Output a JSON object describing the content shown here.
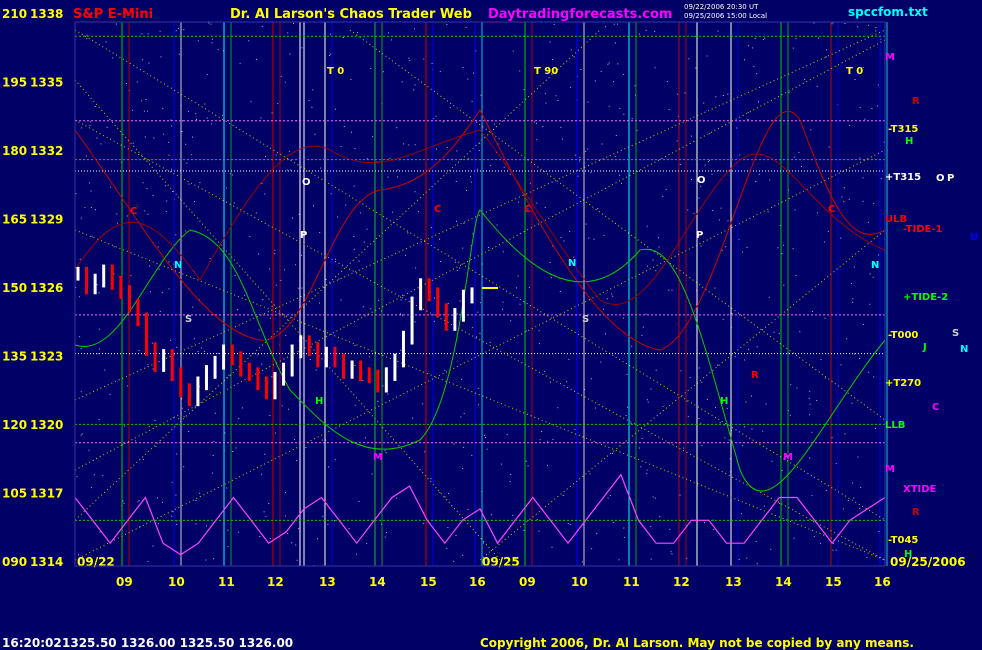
{
  "header": {
    "title_left": "S&P E-Mini",
    "title_center": "Dr. Al Larson's Chaos Trader Web",
    "site": "Daytradingforecasts.com",
    "stamp_line1": "09/22/2006 20:30 UT",
    "stamp_line2": "09/25/2006 15:00 Local",
    "file": "spccfom.txt"
  },
  "footer": {
    "time": "16:20:02",
    "quote": "1325.50  1326.00  1325.50  1326.00",
    "copyright": "Copyright 2006, Dr. Al Larson. May not be copied by any means."
  },
  "colors": {
    "background": "#000066",
    "axis_text": "#ffff00",
    "time_labels": "#ffff00",
    "price_up": "#ffffff",
    "price_down": "#ff0000",
    "fast_field": "#ff44ff",
    "slow_field_green": "#00cc00",
    "slow_field_red": "#cc0000",
    "grid_dots": "#ffffff",
    "diag_lines": "#cccc00",
    "h_lines_green": "#00cc00",
    "h_lines_pink": "#ff66ff"
  },
  "chart_data": {
    "type": "line",
    "title": "S&P E-Mini",
    "y_axis_left": {
      "ticks": [
        {
          "osc": "210",
          "price": "1338"
        },
        {
          "osc": "195",
          "price": "1335"
        },
        {
          "osc": "180",
          "price": "1332"
        },
        {
          "osc": "165",
          "price": "1329"
        },
        {
          "osc": "150",
          "price": "1326"
        },
        {
          "osc": "135",
          "price": "1323"
        },
        {
          "osc": "120",
          "price": "1320"
        },
        {
          "osc": "105",
          "price": "1317"
        },
        {
          "osc": "090",
          "price": "1314"
        }
      ],
      "range": [
        1314,
        1338
      ]
    },
    "x_axis": {
      "hour_ticks": [
        "09",
        "10",
        "11",
        "12",
        "13",
        "14",
        "15",
        "16",
        "09",
        "10",
        "11",
        "12",
        "13",
        "14",
        "15",
        "16"
      ],
      "date_labels": [
        "09/22",
        "09/25",
        "09/25/2006"
      ]
    },
    "session_markers": [
      "T 0",
      "T 90",
      "T 0"
    ],
    "right_labels": [
      {
        "text": "M",
        "color": "#ff00ff"
      },
      {
        "text": "R",
        "color": "#cc0000"
      },
      {
        "text": "-T315",
        "color": "#ffff00"
      },
      {
        "text": "H",
        "color": "#00ff00"
      },
      {
        "text": "+T315",
        "color": "#ffffff"
      },
      {
        "text": "O",
        "color": "#ffffff"
      },
      {
        "text": "P",
        "color": "#ffffff"
      },
      {
        "text": "ULB",
        "color": "#ff0000"
      },
      {
        "text": "-TIDE-1",
        "color": "#ff0000"
      },
      {
        "text": "U",
        "color": "#0000ff"
      },
      {
        "text": "N",
        "color": "#00ffff"
      },
      {
        "text": "+TIDE-2",
        "color": "#00ff00"
      },
      {
        "text": "S",
        "color": "#cccccc"
      },
      {
        "text": "N",
        "color": "#00ffff"
      },
      {
        "text": "-T000",
        "color": "#ffff00"
      },
      {
        "text": "J",
        "color": "#00ff00"
      },
      {
        "text": "+T270",
        "color": "#ffff00"
      },
      {
        "text": "C",
        "color": "#ff00ff"
      },
      {
        "text": "LLB",
        "color": "#00ff00"
      },
      {
        "text": "M",
        "color": "#ff00ff"
      },
      {
        "text": "XTIDE",
        "color": "#ff00ff"
      },
      {
        "text": "R",
        "color": "#cc0000"
      },
      {
        "text": "-T045",
        "color": "#ffff00"
      },
      {
        "text": "H",
        "color": "#00ff00"
      }
    ],
    "in_chart_labels": [
      {
        "text": "C",
        "color": "#ff0000"
      },
      {
        "text": "N",
        "color": "#00ffff"
      },
      {
        "text": "S",
        "color": "#cccccc"
      },
      {
        "text": "O",
        "color": "#ffffff"
      },
      {
        "text": "P",
        "color": "#ffffff"
      },
      {
        "text": "H",
        "color": "#00ff00"
      },
      {
        "text": "M",
        "color": "#ff00ff"
      },
      {
        "text": "C",
        "color": "#ff0000"
      },
      {
        "text": "C",
        "color": "#ff0000"
      },
      {
        "text": "N",
        "color": "#00ffff"
      },
      {
        "text": "S",
        "color": "#cccccc"
      },
      {
        "text": "O",
        "color": "#ffffff"
      },
      {
        "text": "P",
        "color": "#ffffff"
      },
      {
        "text": "R",
        "color": "#ff0000"
      },
      {
        "text": "H",
        "color": "#00ff00"
      },
      {
        "text": "M",
        "color": "#ff00ff"
      },
      {
        "text": "C",
        "color": "#ff0000"
      },
      {
        "text": "N",
        "color": "#00ffff"
      }
    ],
    "price_series": {
      "name": "",
      "values": [
        1326.8,
        1326.2,
        1326.5,
        1326.9,
        1326.4,
        1326.0,
        1325.4,
        1324.8,
        1323.5,
        1322.8,
        1323.2,
        1322.4,
        1321.7,
        1321.3,
        1322.0,
        1322.5,
        1322.9,
        1323.4,
        1323.1,
        1322.6,
        1322.4,
        1322.0,
        1321.6,
        1322.2,
        1322.6,
        1323.4,
        1323.8,
        1323.5,
        1323.0,
        1323.3,
        1323.0,
        1322.5,
        1322.7,
        1322.4,
        1322.3,
        1321.9,
        1322.4,
        1323.0,
        1324.0,
        1325.5,
        1326.3,
        1325.9,
        1325.2,
        1324.6,
        1325.0,
        1325.8,
        1325.9
      ],
      "range": [
        1321.0,
        1327.2
      ]
    },
    "oscillator_series": {
      "name": "",
      "values": [
        1317,
        1316,
        1315,
        1316,
        1317,
        1315,
        1314.5,
        1315,
        1316,
        1317,
        1316,
        1315,
        1315.5,
        1316.5,
        1317,
        1316,
        1315,
        1316,
        1317,
        1317.5,
        1316,
        1315,
        1316,
        1316.5,
        1315,
        1316,
        1317,
        1316,
        1315,
        1316,
        1317,
        1318,
        1316,
        1315,
        1315,
        1316,
        1316,
        1315,
        1315,
        1316,
        1317,
        1317,
        1316,
        1315,
        1316,
        1316.5,
        1317
      ]
    }
  }
}
